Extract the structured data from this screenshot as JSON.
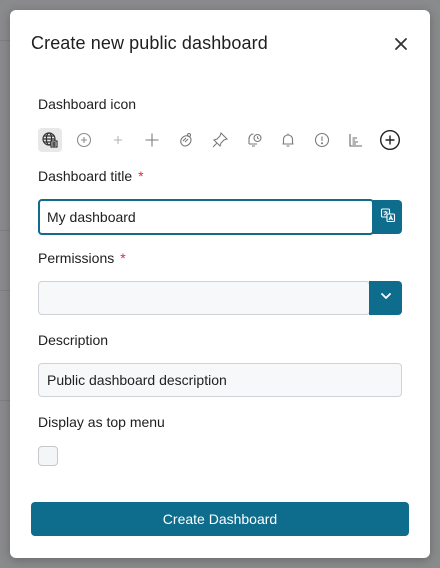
{
  "dialog": {
    "title": "Create new public dashboard",
    "close_icon": "close-icon"
  },
  "icon_picker": {
    "label": "Dashboard icon",
    "icons": [
      {
        "name": "globe-grid-icon",
        "selected": true
      },
      {
        "name": "plus-circle-icon",
        "selected": false
      },
      {
        "name": "plus-thin-icon",
        "selected": false
      },
      {
        "name": "plus-icon",
        "selected": false
      },
      {
        "name": "hand-grab-icon",
        "selected": false
      },
      {
        "name": "pin-icon",
        "selected": false
      },
      {
        "name": "bell-clock-icon",
        "selected": false
      },
      {
        "name": "bell-icon",
        "selected": false
      },
      {
        "name": "alert-circle-icon",
        "selected": false
      },
      {
        "name": "bar-chart-icon",
        "selected": false
      },
      {
        "name": "add-circle-icon",
        "selected": false
      }
    ]
  },
  "title_field": {
    "label": "Dashboard title",
    "required_mark": "*",
    "value": "My dashboard",
    "translate_icon": "translate-icon"
  },
  "permissions_field": {
    "label": "Permissions",
    "required_mark": "*",
    "value": "",
    "dropdown_icon": "chevron-down-icon"
  },
  "description_field": {
    "label": "Description",
    "placeholder": "Public dashboard description",
    "value": ""
  },
  "top_menu": {
    "label": "Display as top menu",
    "checked": false
  },
  "submit": {
    "label": "Create Dashboard"
  },
  "colors": {
    "accent": "#0e6c8c",
    "required": "#d0314a",
    "backdrop": "#8a8b8c"
  }
}
